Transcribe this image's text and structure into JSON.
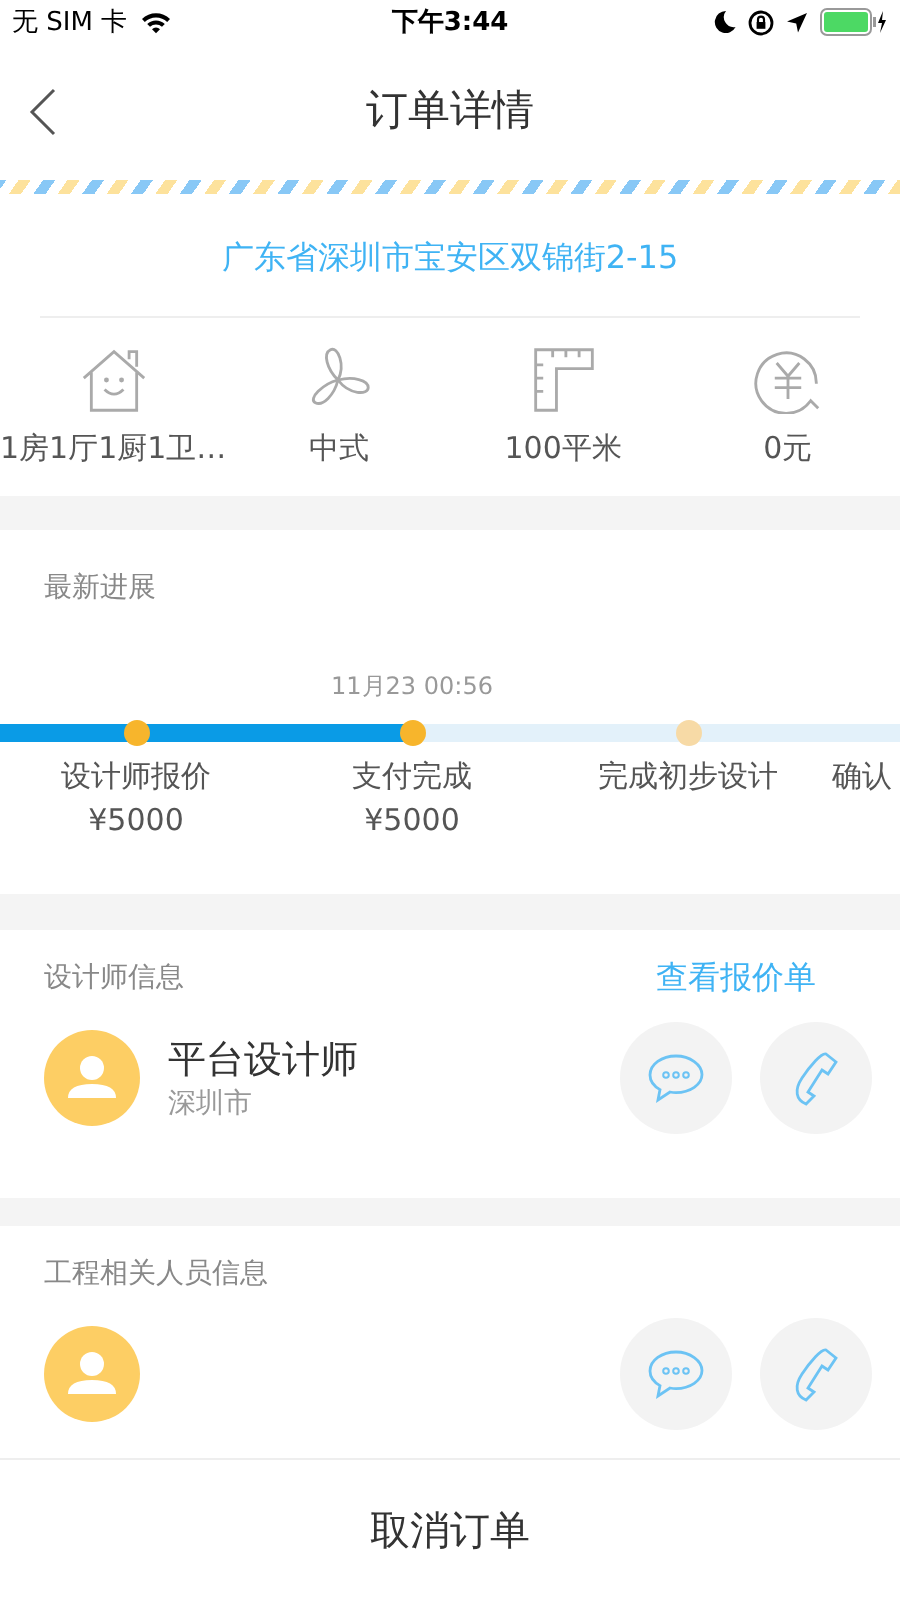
{
  "status_bar": {
    "carrier": "无 SIM 卡",
    "time": "下午3:44"
  },
  "nav": {
    "title": "订单详情"
  },
  "address": "广东省深圳市宝安区双锦街2-15",
  "specs": [
    {
      "kind": "house",
      "label": "1房1厅1厨1卫…"
    },
    {
      "kind": "fan",
      "label": "中式"
    },
    {
      "kind": "ruler",
      "label": "100平米"
    },
    {
      "kind": "yuan",
      "label": "0元"
    }
  ],
  "progress": {
    "title": "最新进展",
    "level": 0.458,
    "steps": [
      {
        "label": "设计师报价",
        "price": "¥5000",
        "done": true
      },
      {
        "label": "支付完成",
        "price": "¥5000",
        "time": "11月23 00:56",
        "done": true
      },
      {
        "label": "完成初步设计",
        "done": false
      },
      {
        "label": "确认"
      }
    ]
  },
  "sections": [
    {
      "title": "设计师信息",
      "link": "查看报价单",
      "people": [
        {
          "kind": "person",
          "name": "平台设计师",
          "city": "深圳市"
        }
      ]
    },
    {
      "title": "工程相关人员信息",
      "people": [
        {
          "kind": "person"
        }
      ]
    }
  ],
  "bottom_button": "取消订单"
}
